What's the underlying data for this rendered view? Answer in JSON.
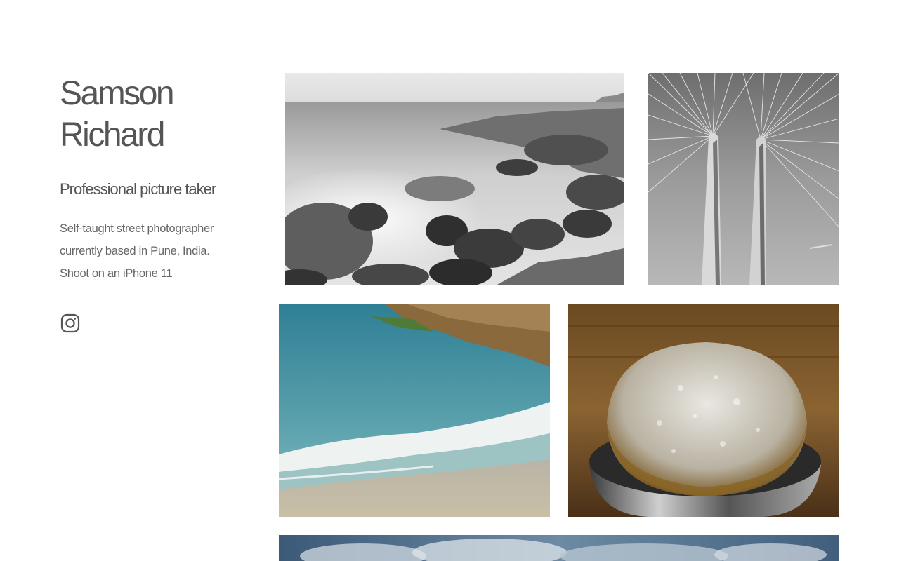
{
  "profile": {
    "name_line1": "Samson",
    "name_line2": "Richard",
    "tagline": "Professional picture taker",
    "bio_lines": [
      "Self-taught street photographer",
      "currently based in Pune, India.",
      "Shoot on an iPhone 11"
    ]
  },
  "social": {
    "icon": "instagram-icon"
  },
  "colors": {
    "text": "#555555",
    "background": "#ffffff"
  },
  "gallery": [
    {
      "subject": "black-and-white-rocky-seashore"
    },
    {
      "subject": "black-and-white-cable-bridge"
    },
    {
      "subject": "beach-waves-and-rocks"
    },
    {
      "subject": "frothy-coffee-cup"
    },
    {
      "subject": "cloudy-sky"
    }
  ]
}
